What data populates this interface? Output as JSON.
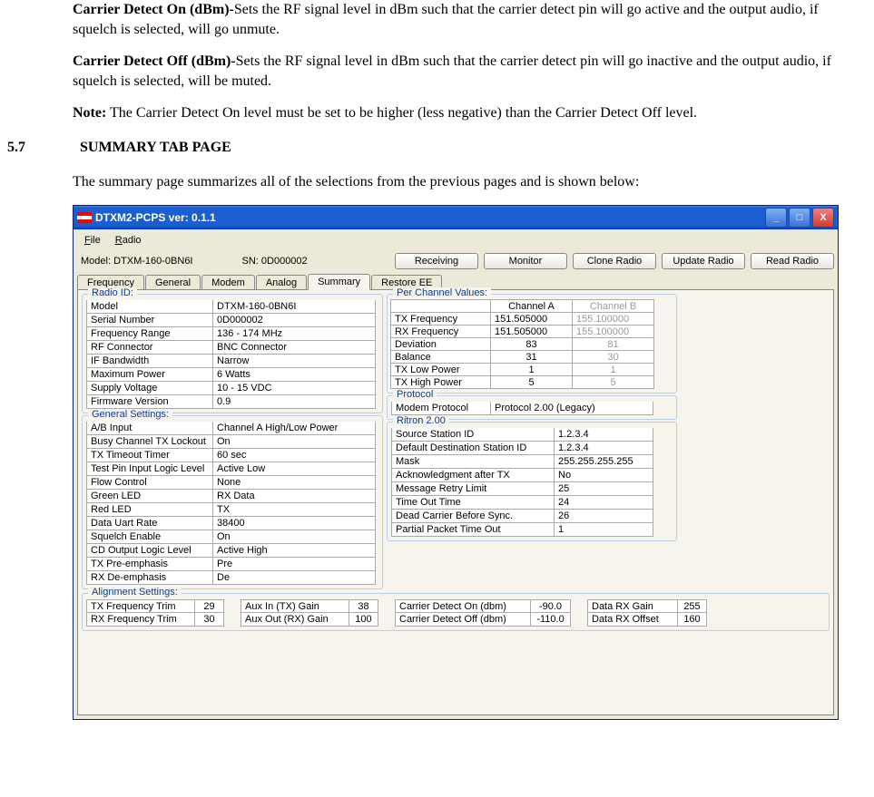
{
  "doc": {
    "p1_bold": "Carrier Detect On (dBm)-",
    "p1_rest": "Sets the RF signal level in dBm such that the carrier detect pin will go active and the output audio, if squelch is selected, will go unmute.",
    "p2_bold": "Carrier Detect Off (dBm)-",
    "p2_rest": "Sets the RF signal level in dBm such that the carrier detect pin will go inactive and the output audio, if squelch is selected, will be muted.",
    "p3_bold": "Note:",
    "p3_rest": "  The Carrier Detect On level must be set to be higher (less negative) than the Carrier Detect Off level.",
    "sectnum": "5.7",
    "secttitle": "SUMMARY TAB PAGE",
    "p4": "The summary page summarizes all of the selections from the previous pages and is shown below:"
  },
  "win": {
    "title": "DTXM2-PCPS ver: 0.1.1",
    "menu": {
      "file": "File",
      "radio": "Radio"
    },
    "info": {
      "model_lbl": "Model: DTXM-160-0BN6I",
      "sn_lbl": "SN: 0D000002"
    },
    "toolbar": {
      "receiving": "Receiving",
      "monitor": "Monitor",
      "clone": "Clone Radio",
      "update": "Update Radio",
      "read": "Read Radio"
    },
    "tabs": {
      "freq": "Frequency",
      "gen": "General",
      "modem": "Modem",
      "analog": "Analog",
      "summary": "Summary",
      "restore": "Restore EE"
    }
  },
  "radio_id": {
    "title": "Radio ID:",
    "rows": {
      "model": {
        "k": "Model",
        "v": "DTXM-160-0BN6I"
      },
      "sn": {
        "k": "Serial Number",
        "v": "0D000002"
      },
      "freq": {
        "k": "Frequency Range",
        "v": "136 - 174 MHz"
      },
      "rf": {
        "k": "RF Connector",
        "v": "BNC Connector"
      },
      "ifbw": {
        "k": "IF Bandwidth",
        "v": "Narrow"
      },
      "maxp": {
        "k": "Maximum Power",
        "v": "6 Watts"
      },
      "sv": {
        "k": "Supply Voltage",
        "v": "10 - 15 VDC"
      },
      "fw": {
        "k": "Firmware Version",
        "v": "0.9"
      }
    }
  },
  "general": {
    "title": "General Settings:",
    "rows": {
      "ab": {
        "k": "A/B Input",
        "v": "Channel A High/Low Power"
      },
      "busy": {
        "k": "Busy Channel TX Lockout",
        "v": "On"
      },
      "txto": {
        "k": "TX Timeout Timer",
        "v": "60 sec"
      },
      "test": {
        "k": "Test Pin Input Logic Level",
        "v": "Active Low"
      },
      "flow": {
        "k": "Flow Control",
        "v": "None"
      },
      "gled": {
        "k": "Green LED",
        "v": "RX Data"
      },
      "rled": {
        "k": "Red LED",
        "v": "TX"
      },
      "uart": {
        "k": "Data Uart Rate",
        "v": "38400"
      },
      "sq": {
        "k": "Squelch Enable",
        "v": "On"
      },
      "cd": {
        "k": "CD Output Logic Level",
        "v": "Active High"
      },
      "txpe": {
        "k": "TX Pre-emphasis",
        "v": "Pre"
      },
      "rxde": {
        "k": "RX De-emphasis",
        "v": "De"
      }
    }
  },
  "perch": {
    "title": "Per Channel Values:",
    "hdr": {
      "a": "Channel A",
      "b": "Channel B"
    },
    "rows": {
      "txf": {
        "k": "TX Frequency",
        "a": "151.505000",
        "b": "155.100000"
      },
      "rxf": {
        "k": "RX Frequency",
        "a": "151.505000",
        "b": "155.100000"
      },
      "dev": {
        "k": "Deviation",
        "a": "83",
        "b": "81"
      },
      "bal": {
        "k": "Balance",
        "a": "31",
        "b": "30"
      },
      "txl": {
        "k": "TX Low Power",
        "a": "1",
        "b": "1"
      },
      "txh": {
        "k": "TX High Power",
        "a": "5",
        "b": "5"
      }
    }
  },
  "protocol": {
    "title": "Protocol",
    "row": {
      "k": "Modem Protocol",
      "v": "Protocol 2.00 (Legacy)"
    }
  },
  "ritron": {
    "title": "Ritron 2.00",
    "rows": {
      "src": {
        "k": "Source Station ID",
        "v": "1.2.3.4"
      },
      "dst": {
        "k": "Default Destination Station ID",
        "v": "1.2.3.4"
      },
      "mask": {
        "k": "Mask",
        "v": "255.255.255.255"
      },
      "ack": {
        "k": "Acknowledgment after TX",
        "v": "No"
      },
      "retry": {
        "k": "Message Retry Limit",
        "v": "25"
      },
      "tot": {
        "k": "Time Out Time",
        "v": "24"
      },
      "dcbs": {
        "k": "Dead Carrier Before Sync.",
        "v": "26"
      },
      "ppto": {
        "k": "Partial Packet Time Out",
        "v": "1"
      }
    }
  },
  "align": {
    "title": "Alignment Settings:",
    "txtrim": {
      "k": "TX Frequency Trim",
      "v": "29"
    },
    "rxtrim": {
      "k": "RX Frequency Trim",
      "v": "30"
    },
    "auxin": {
      "k": "Aux In (TX) Gain",
      "v": "38"
    },
    "auxout": {
      "k": "Aux Out (RX) Gain",
      "v": "100"
    },
    "cdon": {
      "k": "Carrier Detect On (dbm)",
      "v": "-90.0"
    },
    "cdoff": {
      "k": "Carrier Detect Off (dbm)",
      "v": "-110.0"
    },
    "drxg": {
      "k": "Data RX Gain",
      "v": "255"
    },
    "drxo": {
      "k": "Data RX Offset",
      "v": "160"
    }
  }
}
